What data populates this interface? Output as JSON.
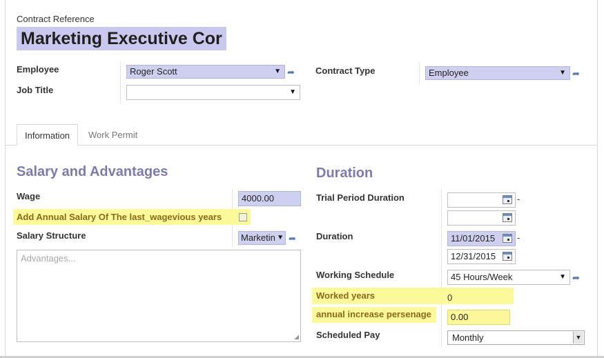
{
  "header": {
    "ref_label": "Contract Reference",
    "title": "Marketing Executive Cor"
  },
  "top_fields": {
    "employee_label": "Employee",
    "employee_value": "Roger Scott",
    "job_title_label": "Job Title",
    "job_title_value": "",
    "contract_type_label": "Contract Type",
    "contract_type_value": "Employee"
  },
  "tabs": [
    {
      "label": "Information",
      "active": true
    },
    {
      "label": "Work Permit",
      "active": false
    }
  ],
  "salary": {
    "section_title": "Salary and Advantages",
    "wage_label": "Wage",
    "wage_value": "4000.00",
    "annual_label": "Add Annual Salary Of The last_wagevious years",
    "annual_checked": false,
    "structure_label": "Salary Structure",
    "structure_value": "Marketin",
    "advantages_placeholder": "Advantages..."
  },
  "duration": {
    "section_title": "Duration",
    "trial_label": "Trial Period Duration",
    "trial_start": "",
    "trial_end": "",
    "trial_separator": "-",
    "duration_label": "Duration",
    "duration_start": "11/01/2015",
    "duration_end": "12/31/2015",
    "duration_separator": "-",
    "schedule_label": "Working Schedule",
    "schedule_value": "45 Hours/Week",
    "worked_years_label": "Worked years",
    "worked_years_value": "0",
    "increase_label": "annual increase persenage",
    "increase_value": "0.00",
    "pay_label": "Scheduled Pay",
    "pay_value": "Monthly"
  },
  "icons": {
    "dropdown": "chevron-down-icon",
    "external": "external-link-icon",
    "calendar": "calendar-icon",
    "resize": "resize-grip-icon"
  },
  "colors": {
    "title_bg": "#c9c9ef",
    "required_field_bg": "#cfcfef",
    "highlight": "#fbf99a",
    "section_title": "#7c7bad"
  }
}
